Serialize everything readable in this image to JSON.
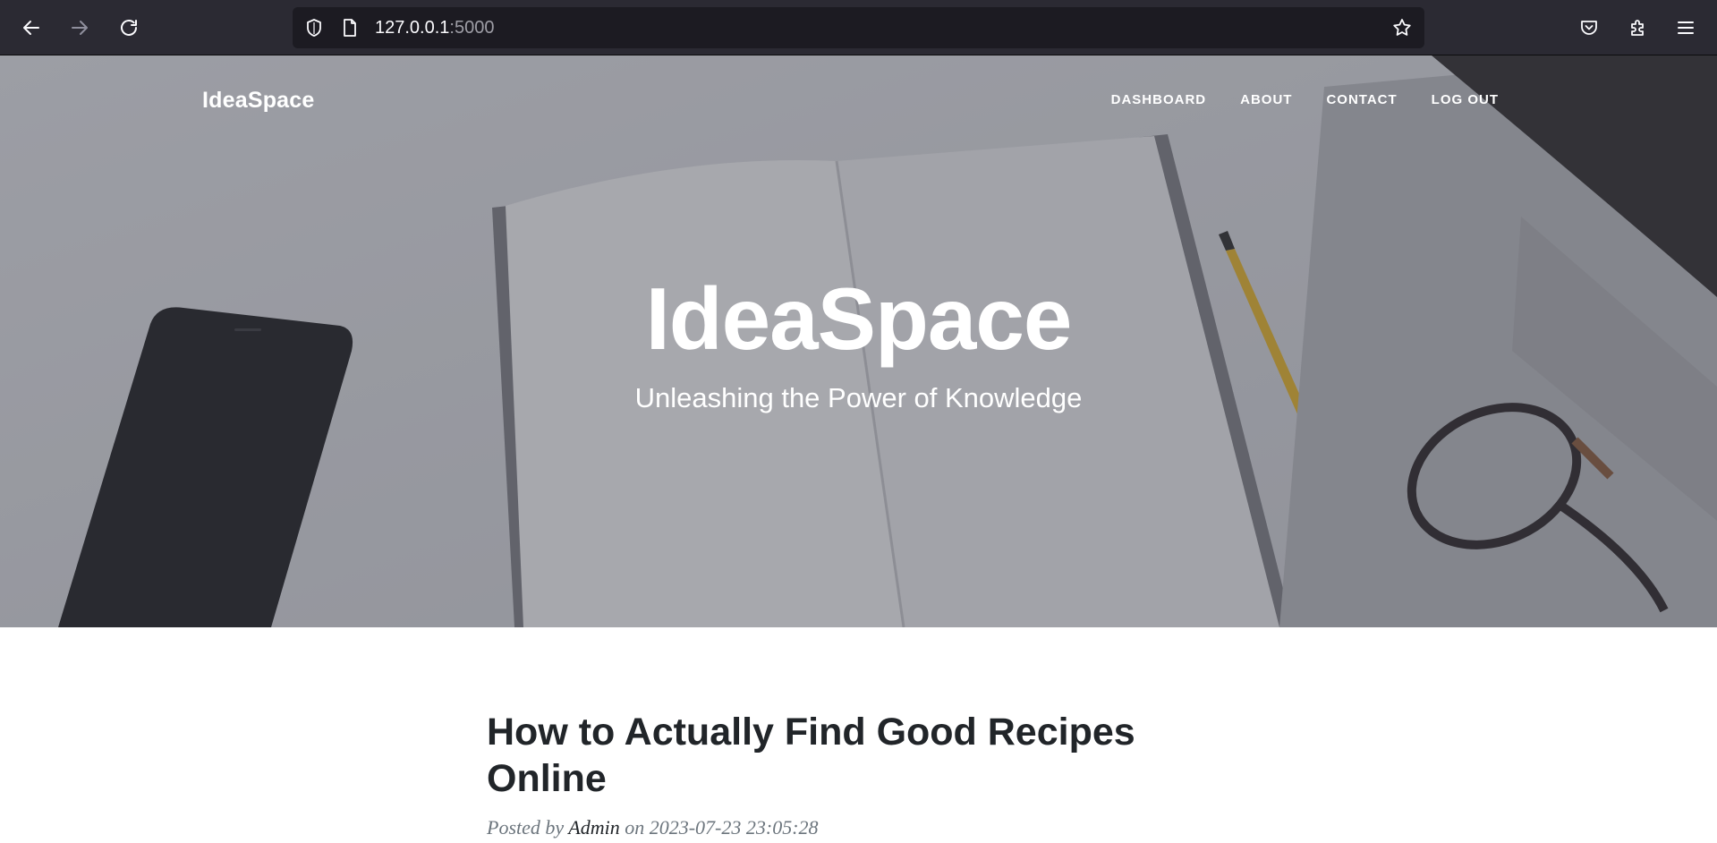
{
  "browser": {
    "url_host": "127.0.0.1",
    "url_port": ":5000",
    "icons": [
      "back-icon",
      "forward-icon",
      "reload-icon",
      "shield-icon",
      "page-icon",
      "star-icon",
      "pocket-icon",
      "extensions-icon",
      "menu-icon"
    ]
  },
  "nav": {
    "brand": "IdeaSpace",
    "links": [
      "DASHBOARD",
      "ABOUT",
      "CONTACT",
      "LOG OUT"
    ]
  },
  "hero": {
    "title": "IdeaSpace",
    "subtitle": "Unleashing the Power of Knowledge"
  },
  "post": {
    "title": "How to Actually Find Good Recipes Online",
    "posted_by_prefix": "Posted by",
    "author": "Admin",
    "on_word": "on",
    "date": "2023-07-23 23:05:28"
  },
  "colors": {
    "chrome_bg": "#2b2a33",
    "urlbar_bg": "#1c1b22",
    "heading_text": "#212529",
    "meta_text": "#6c757d"
  }
}
